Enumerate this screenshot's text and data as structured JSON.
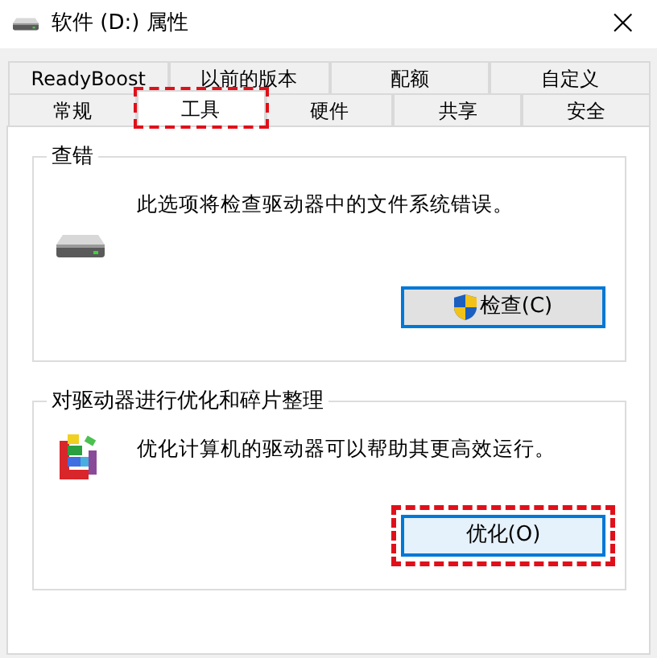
{
  "window": {
    "title": "软件 (D:) 属性",
    "close": "×"
  },
  "tab_rows": [
    [
      {
        "label": "ReadyBoost",
        "selected": false,
        "highlighted": false
      },
      {
        "label": "以前的版本",
        "selected": false,
        "highlighted": false
      },
      {
        "label": "配额",
        "selected": false,
        "highlighted": false
      },
      {
        "label": "自定义",
        "selected": false,
        "highlighted": false
      }
    ],
    [
      {
        "label": "常规",
        "selected": false,
        "highlighted": false
      },
      {
        "label": "工具",
        "selected": true,
        "highlighted": true
      },
      {
        "label": "硬件",
        "selected": false,
        "highlighted": false
      },
      {
        "label": "共享",
        "selected": false,
        "highlighted": false
      },
      {
        "label": "安全",
        "selected": false,
        "highlighted": false
      }
    ]
  ],
  "groups": [
    {
      "kind": "check",
      "title": "查错",
      "text": "此选项将检查驱动器中的文件系统错误。",
      "button": {
        "label": "检查(C)",
        "shield": true,
        "focused": true,
        "highlighted": false
      }
    },
    {
      "kind": "optimize",
      "title": "对驱动器进行优化和碎片整理",
      "text": "优化计算机的驱动器可以帮助其更高效运行。",
      "button": {
        "label": "优化(O)",
        "shield": false,
        "focused": false,
        "highlighted": true
      }
    }
  ]
}
